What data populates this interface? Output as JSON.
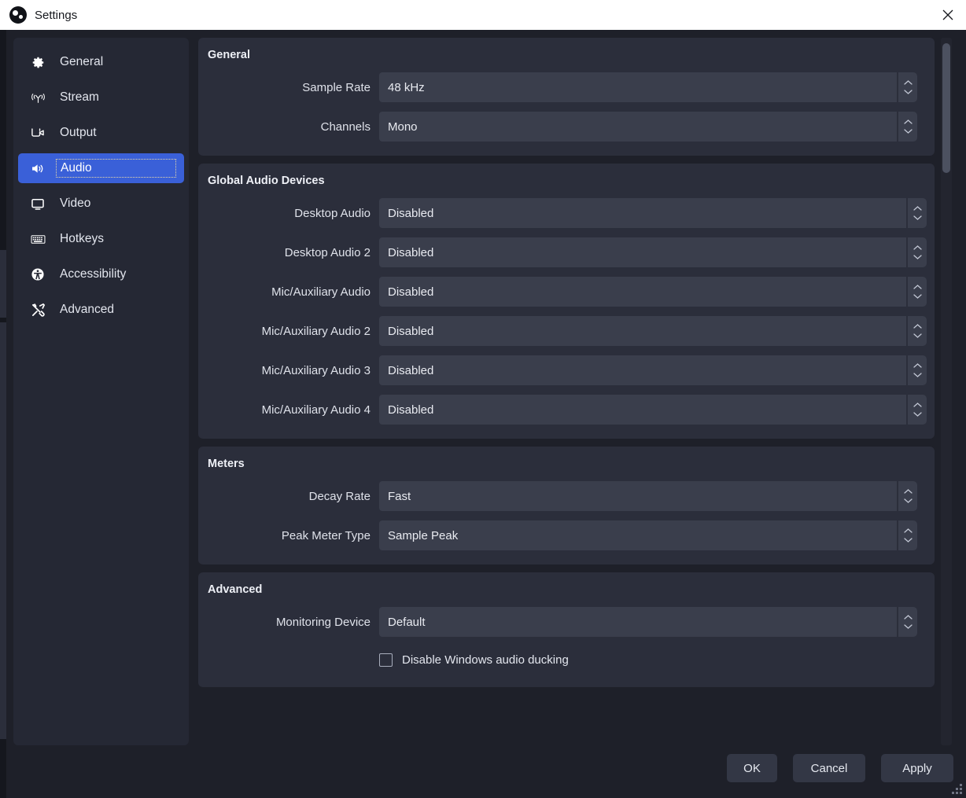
{
  "window": {
    "title": "Settings",
    "app_icon": "obs-logo-icon",
    "close_icon": "close-icon"
  },
  "sidebar": {
    "items": [
      {
        "label": "General",
        "icon": "gear-icon",
        "selected": false
      },
      {
        "label": "Stream",
        "icon": "broadcast-icon",
        "selected": false
      },
      {
        "label": "Output",
        "icon": "video-camera-icon",
        "selected": false
      },
      {
        "label": "Audio",
        "icon": "speaker-icon",
        "selected": true
      },
      {
        "label": "Video",
        "icon": "monitor-icon",
        "selected": false
      },
      {
        "label": "Hotkeys",
        "icon": "keyboard-icon",
        "selected": false
      },
      {
        "label": "Accessibility",
        "icon": "accessibility-icon",
        "selected": false
      },
      {
        "label": "Advanced",
        "icon": "tools-icon",
        "selected": false
      }
    ]
  },
  "content": {
    "groups": [
      {
        "title": "General",
        "rows": [
          {
            "label": "Sample Rate",
            "value": "48 kHz"
          },
          {
            "label": "Channels",
            "value": "Mono"
          }
        ]
      },
      {
        "title": "Global Audio Devices",
        "rows": [
          {
            "label": "Desktop Audio",
            "value": "Disabled"
          },
          {
            "label": "Desktop Audio 2",
            "value": "Disabled"
          },
          {
            "label": "Mic/Auxiliary Audio",
            "value": "Disabled"
          },
          {
            "label": "Mic/Auxiliary Audio 2",
            "value": "Disabled"
          },
          {
            "label": "Mic/Auxiliary Audio 3",
            "value": "Disabled"
          },
          {
            "label": "Mic/Auxiliary Audio 4",
            "value": "Disabled"
          }
        ]
      },
      {
        "title": "Meters",
        "rows": [
          {
            "label": "Decay Rate",
            "value": "Fast"
          },
          {
            "label": "Peak Meter Type",
            "value": "Sample Peak"
          }
        ]
      },
      {
        "title": "Advanced",
        "rows": [
          {
            "label": "Monitoring Device",
            "value": "Default"
          }
        ],
        "checkbox": {
          "label": "Disable Windows audio ducking",
          "checked": false
        }
      }
    ]
  },
  "footer": {
    "ok_label": "OK",
    "cancel_label": "Cancel",
    "apply_label": "Apply"
  },
  "colors": {
    "titlebar_bg": "#ffffff",
    "window_bg": "#1e2029",
    "sidebar_bg": "#252834",
    "group_bg": "#2b2e3b",
    "field_bg": "#3a3e4c",
    "accent_selected": "#3a60d8",
    "focus_outline": "#e8d8a8",
    "text_primary": "#e3e6ee"
  }
}
